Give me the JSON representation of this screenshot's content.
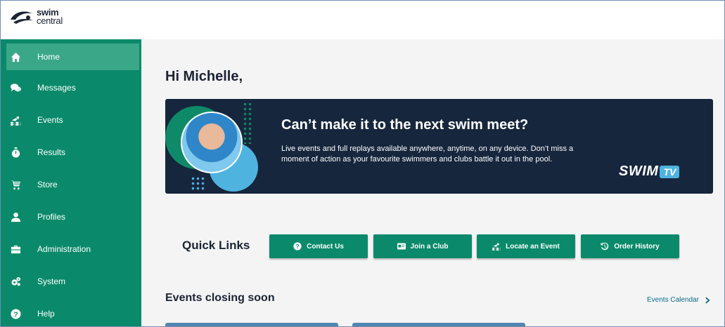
{
  "brand": {
    "name_line1": "swim",
    "name_line2": "central"
  },
  "sidebar": {
    "items": [
      {
        "label": "Home",
        "icon": "home-icon",
        "active": true
      },
      {
        "label": "Messages",
        "icon": "chat-bubbles-icon",
        "active": false
      },
      {
        "label": "Events",
        "icon": "swimmer-icon",
        "active": false
      },
      {
        "label": "Results",
        "icon": "stopwatch-icon",
        "active": false
      },
      {
        "label": "Store",
        "icon": "shopping-cart-icon",
        "active": false
      },
      {
        "label": "Profiles",
        "icon": "user-icon",
        "active": false
      },
      {
        "label": "Administration",
        "icon": "briefcase-icon",
        "active": false
      },
      {
        "label": "System",
        "icon": "gears-icon",
        "active": false
      },
      {
        "label": "Help",
        "icon": "question-circle-icon",
        "active": false
      }
    ]
  },
  "main": {
    "greeting": "Hi Michelle,",
    "banner": {
      "title": "Can’t make it to the next swim meet?",
      "body": "Live events and full replays available anywhere, anytime, on any device. Don’t miss a moment of action as your favourite swimmers and clubs battle it out in the pool.",
      "logo_word": "SWIM",
      "logo_badge": "TV"
    },
    "quick_links": {
      "title": "Quick Links",
      "buttons": [
        {
          "label": "Contact Us",
          "icon": "question-circle-icon"
        },
        {
          "label": "Join a Club",
          "icon": "id-card-icon"
        },
        {
          "label": "Locate an Event",
          "icon": "swimmer-icon"
        },
        {
          "label": "Order History",
          "icon": "history-icon"
        }
      ]
    },
    "events_section": {
      "title": "Events closing soon",
      "calendar_link": "Events Calendar"
    }
  },
  "colors": {
    "primary": "#0a8a6a",
    "active_nav": "#3aa888",
    "banner_bg": "#16263d",
    "accent_blue": "#4fb3e0"
  }
}
